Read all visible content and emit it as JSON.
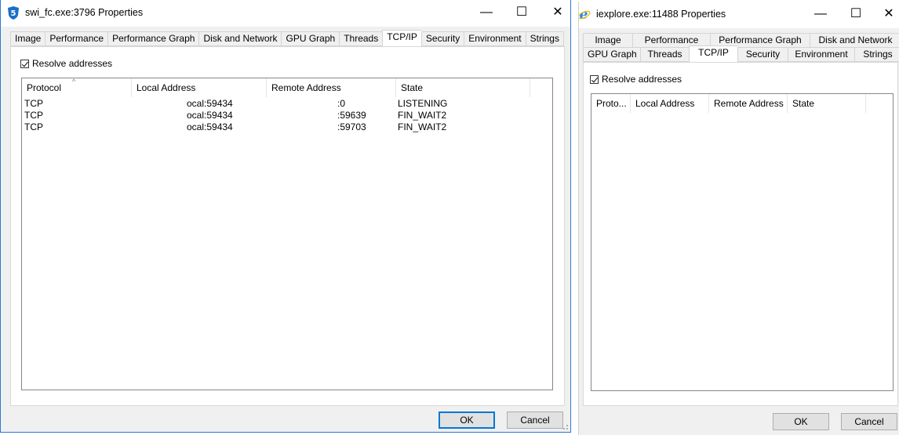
{
  "win1": {
    "title": "swi_fc.exe:3796 Properties",
    "app_icon_glyph": "5",
    "controls": {
      "minimize": "—",
      "maximize": "☐",
      "close": "✕"
    },
    "tabs": [
      {
        "label": "Image",
        "active": false
      },
      {
        "label": "Performance",
        "active": false
      },
      {
        "label": "Performance Graph",
        "active": false
      },
      {
        "label": "Disk and Network",
        "active": false
      },
      {
        "label": "GPU Graph",
        "active": false
      },
      {
        "label": "Threads",
        "active": false
      },
      {
        "label": "TCP/IP",
        "active": true
      },
      {
        "label": "Security",
        "active": false
      },
      {
        "label": "Environment",
        "active": false
      },
      {
        "label": "Strings",
        "active": false
      }
    ],
    "resolve_label": "Resolve addresses",
    "resolve_checked": true,
    "columns": [
      "Protocol",
      "Local Address",
      "Remote Address",
      "State"
    ],
    "sort_glyph": "^",
    "rows": [
      {
        "protocol": "TCP",
        "local": "ocal:59434",
        "remote": ":0",
        "state": "LISTENING"
      },
      {
        "protocol": "TCP",
        "local": "ocal:59434",
        "remote": ":59639",
        "state": "FIN_WAIT2"
      },
      {
        "protocol": "TCP",
        "local": "ocal:59434",
        "remote": ":59703",
        "state": "FIN_WAIT2"
      }
    ],
    "ok_label": "OK",
    "cancel_label": "Cancel"
  },
  "win2": {
    "title": "iexplore.exe:11488 Properties",
    "app_icon_glyph": "e",
    "controls": {
      "minimize": "—",
      "maximize": "☐",
      "close": "✕"
    },
    "tabs_row1": [
      "Image",
      "Performance",
      "Performance Graph",
      "Disk and Network"
    ],
    "tabs_row2": [
      {
        "label": "GPU Graph",
        "active": false
      },
      {
        "label": "Threads",
        "active": false
      },
      {
        "label": "TCP/IP",
        "active": true
      },
      {
        "label": "Security",
        "active": false
      },
      {
        "label": "Environment",
        "active": false
      },
      {
        "label": "Strings",
        "active": false
      }
    ],
    "resolve_label": "Resolve addresses",
    "resolve_checked": true,
    "columns": [
      "Proto...",
      "Local Address",
      "Remote Address",
      "State"
    ],
    "ok_label": "OK",
    "cancel_label": "Cancel"
  },
  "colors": {
    "accent": "#0078d7",
    "ie_blue": "#1e88e5"
  }
}
